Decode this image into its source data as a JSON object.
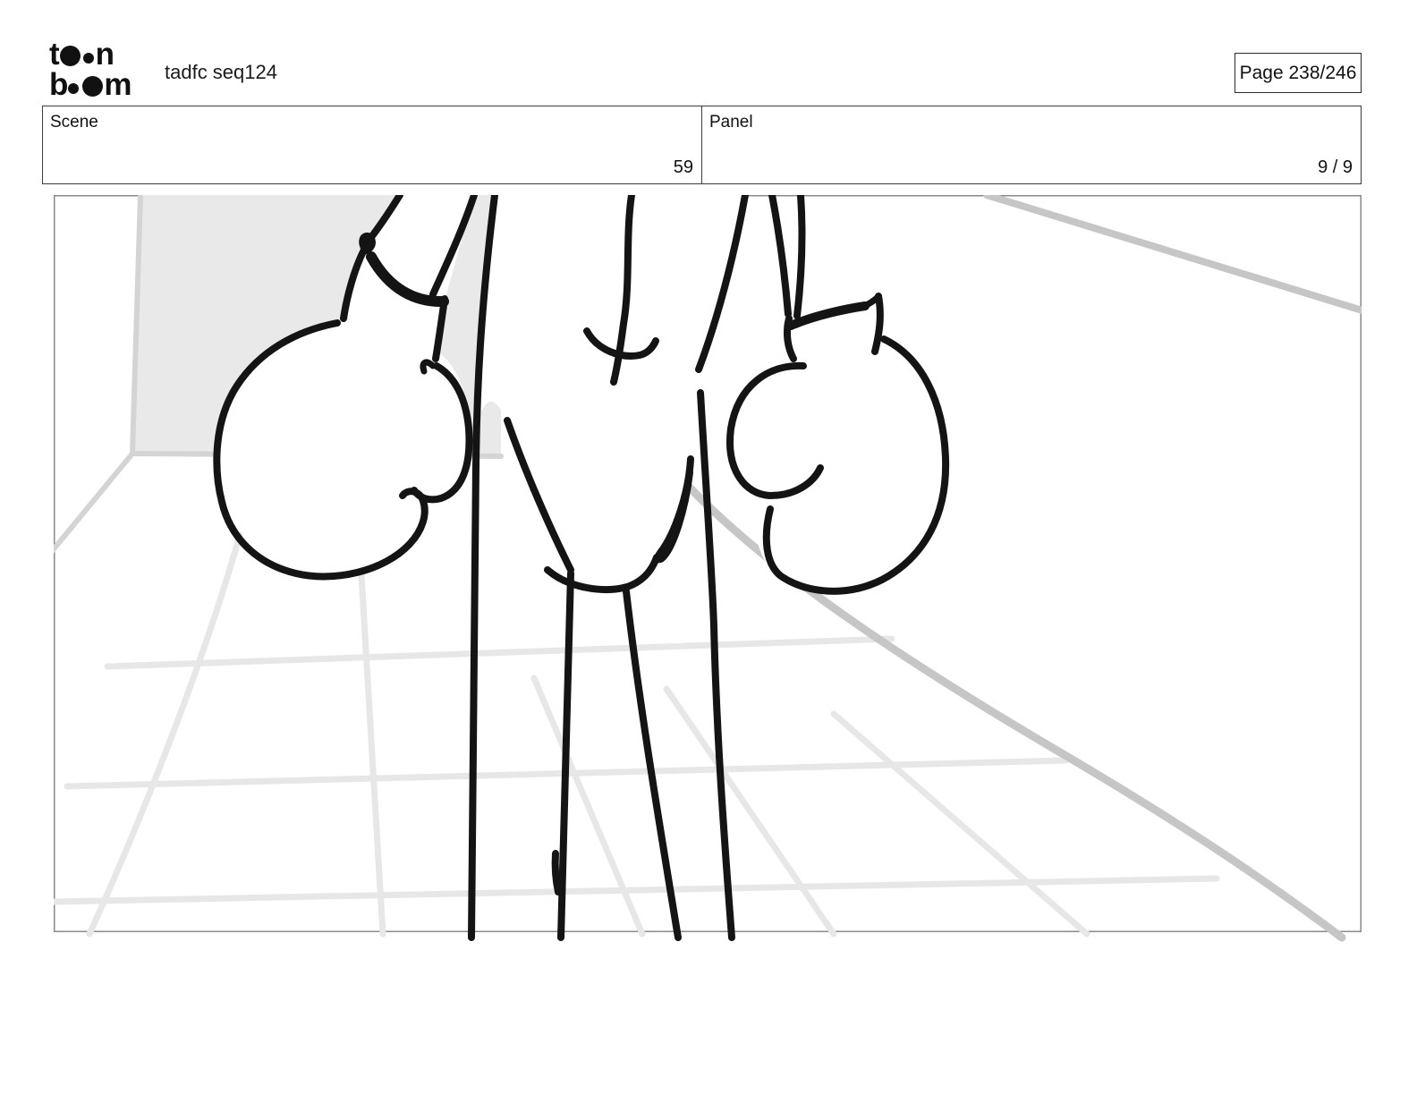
{
  "header": {
    "logo": {
      "brand": "toon boom",
      "line1_start": "t",
      "line1_end": "n",
      "line2_start": "b",
      "line2_end": "m"
    },
    "project_title": "tadfc seq124",
    "page_label": "Page 238/246"
  },
  "info_bar": {
    "scene": {
      "label": "Scene",
      "value": "59"
    },
    "panel": {
      "label": "Panel",
      "value": "9 / 9"
    }
  },
  "storyboard_panel": {
    "alt_text": "Rough storyboard sketch: lower body of a cartoon character with boxing gloves hanging at both sides, standing on a perspective floor grid; gray wall block at upper left"
  },
  "colors": {
    "ink": "#141414",
    "frame_border": "#8a8a8a",
    "wall_fill": "#e9e9e9",
    "wall_edge": "#d4d4d4",
    "grid_light": "#e7e7e7",
    "grid_medium": "#c6c6c6",
    "ring_edge_dark": "#c7caca",
    "header_text": "#111111"
  }
}
